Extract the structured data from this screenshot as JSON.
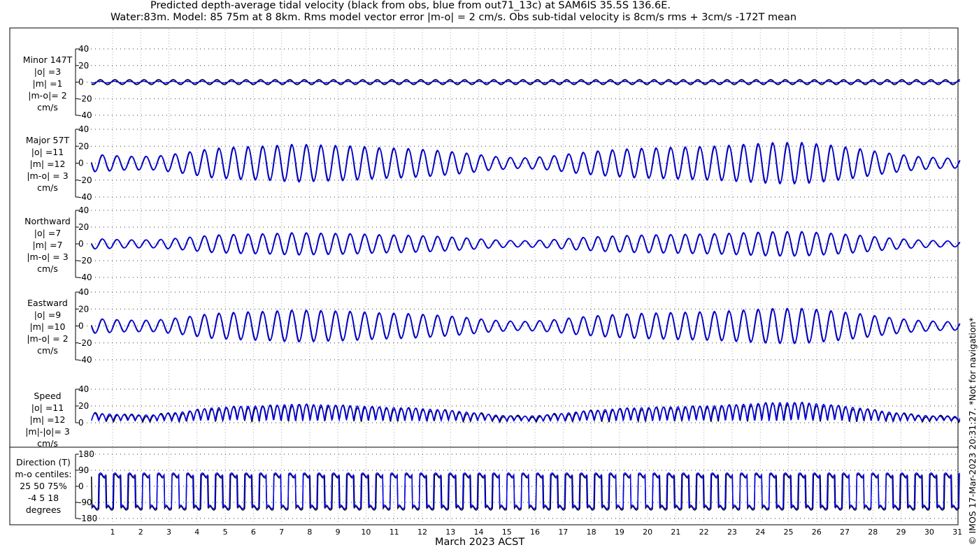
{
  "chart_data": {
    "type": "line",
    "title": [
      "Predicted depth-average tidal velocity (black from obs, blue from out71_13c) at SAM6IS 35.5S 136.6E.",
      "Water:83m. Model: 85 75m at 8 8km. Rms model vector error |m-o| = 2 cm/s. Obs sub-tidal velocity is 8cm/s rms + 3cm/s -172T mean"
    ],
    "xlabel": "March 2023 ACST",
    "x_ticks": [
      "1",
      "2",
      "3",
      "4",
      "5",
      "6",
      "7",
      "8",
      "9",
      "10",
      "11",
      "12",
      "13",
      "14",
      "15",
      "16",
      "17",
      "18",
      "19",
      "20",
      "21",
      "22",
      "23",
      "24",
      "25",
      "26",
      "27",
      "28",
      "29",
      "30",
      "31"
    ],
    "xlim_days": [
      0.25,
      31.1
    ],
    "series_legend": {
      "obs": "black",
      "model": "blue"
    },
    "colors": {
      "obs": "#000000",
      "model": "#0000ff"
    },
    "major_daily_amplitude_cms": [
      10,
      8,
      8,
      12,
      17,
      19,
      20,
      22,
      21,
      20,
      18,
      17,
      15,
      12,
      8,
      6,
      8,
      12,
      15,
      17,
      18,
      19,
      20,
      22,
      24,
      24,
      21,
      17,
      12,
      8,
      6
    ],
    "panels": [
      {
        "id": "minor",
        "label": [
          "Minor 147T",
          "|o| =3",
          "|m| =1",
          "|m-o|= 2",
          "cm/s"
        ],
        "ylim": [
          -40,
          40
        ],
        "yticks": [
          "40",
          "20",
          "0",
          "-20",
          "-40"
        ],
        "scale": 0.15
      },
      {
        "id": "major",
        "label": [
          "Major 57T",
          "|o| =11",
          "|m| =12",
          "|m-o| = 3",
          "cm/s"
        ],
        "ylim": [
          -40,
          40
        ],
        "yticks": [
          "40",
          "20",
          "0",
          "-20",
          "-40"
        ],
        "scale": 1
      },
      {
        "id": "north",
        "label": [
          "Northward",
          "|o| =7",
          "|m| =7",
          "|m-o| = 3",
          "cm/s"
        ],
        "ylim": [
          -40,
          40
        ],
        "yticks": [
          "40",
          "20",
          "0",
          "-20",
          "-40"
        ],
        "scale": 0.6
      },
      {
        "id": "east",
        "label": [
          "Eastward",
          "|o| =9",
          "|m| =10",
          "|m-o| = 2",
          "cm/s"
        ],
        "ylim": [
          -40,
          40
        ],
        "yticks": [
          "40",
          "20",
          "0",
          "-20",
          "-40"
        ],
        "scale": 0.85
      },
      {
        "id": "speed",
        "label": [
          "Speed",
          "|o| =11",
          "|m| =12",
          "|m|-|o|= 3",
          "cm/s"
        ],
        "ylim": [
          0,
          40
        ],
        "yticks": [
          "40",
          "20",
          "0"
        ],
        "scale": 1
      },
      {
        "id": "direction",
        "label": [
          "Direction (T)",
          "m-o centiles:",
          "25  50  75%",
          "-4   5  18",
          "degrees"
        ],
        "ylim": [
          -180,
          180
        ],
        "yticks": [
          "180",
          "90",
          "0",
          "-90",
          "-180"
        ],
        "scale": 1
      }
    ]
  },
  "footer": "© IMOS 17-Mar-2023 20:31:27. *Not for navigation*"
}
